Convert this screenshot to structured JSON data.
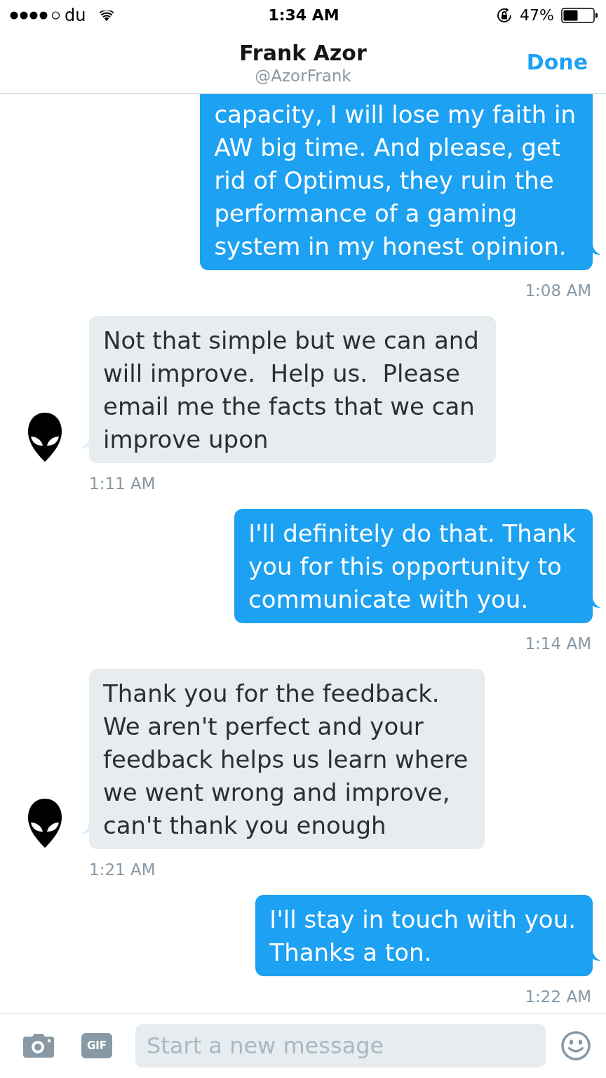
{
  "status_bar": {
    "carrier": "du",
    "time": "1:34 AM",
    "battery": "47%"
  },
  "header": {
    "name": "Frank Azor",
    "handle": "@AzorFrank",
    "done": "Done"
  },
  "messages": [
    {
      "kind": "sent",
      "clipped_top": true,
      "text": "capacity, I will lose my faith in\nAW big time. And please, get\nrid of Optimus, they ruin the\nperformance of a gaming\nsystem in my honest opinion.",
      "time": "1:08 AM"
    },
    {
      "kind": "received",
      "clipped_top": false,
      "text": "Not that simple but we can and\nwill improve.  Help us.  Please\nemail me the facts that we can\nimprove upon",
      "time": "1:11 AM"
    },
    {
      "kind": "sent",
      "clipped_top": false,
      "text": "I'll definitely do that. Thank\nyou for this opportunity to\ncommunicate with you.",
      "time": "1:14 AM"
    },
    {
      "kind": "received",
      "clipped_top": false,
      "text": "Thank you for the feedback.\nWe aren't perfect and your\nfeedback helps us learn where\nwe went wrong and improve,\ncan't thank you enough",
      "time": "1:21 AM"
    },
    {
      "kind": "sent",
      "clipped_top": false,
      "text": "I'll stay in touch with you.\nThanks a ton.",
      "time": "1:22 AM"
    }
  ],
  "composer": {
    "gif": "GIF",
    "placeholder": "Start a new message"
  }
}
